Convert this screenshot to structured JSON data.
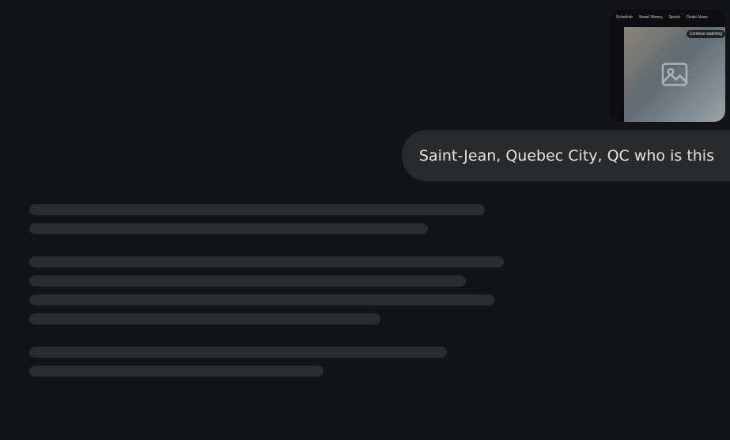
{
  "attachment": {
    "nav_items": [
      "Schedule",
      "Smart Money",
      "Sports",
      "Deals News"
    ],
    "overlay_label": "Continue watching"
  },
  "user_message": {
    "text": "Saint-Jean, Quebec City, QC who is this"
  }
}
